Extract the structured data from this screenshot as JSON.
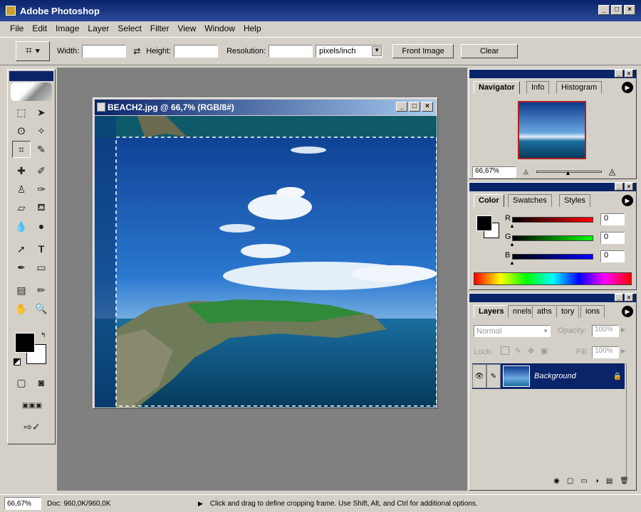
{
  "window": {
    "title": "Adobe Photoshop"
  },
  "menu": [
    "File",
    "Edit",
    "Image",
    "Layer",
    "Select",
    "Filter",
    "View",
    "Window",
    "Help"
  ],
  "options": {
    "width_label": "Width:",
    "height_label": "Height:",
    "resolution_label": "Resolution:",
    "unit_value": "pixels/inch",
    "front_image": "Front Image",
    "clear": "Clear"
  },
  "document": {
    "title": "BEACH2.jpg @ 66,7% (RGB/8#)"
  },
  "navigator": {
    "tabs": [
      "Navigator",
      "Info",
      "Histogram"
    ],
    "zoom": "66,67%"
  },
  "color": {
    "tabs": [
      "Color",
      "Swatches",
      "Styles"
    ],
    "channels": [
      {
        "label": "R",
        "value": "0"
      },
      {
        "label": "G",
        "value": "0"
      },
      {
        "label": "B",
        "value": "0"
      }
    ]
  },
  "layers": {
    "tabs": [
      "Layers",
      "nnels",
      "aths",
      "tory",
      "ions"
    ],
    "blend_mode": "Normal",
    "opacity_label": "Opacity:",
    "opacity_value": "100%",
    "lock_label": "Lock:",
    "fill_label": "Fill:",
    "fill_value": "100%",
    "layer_name": "Background"
  },
  "status": {
    "zoom": "66,67%",
    "doc": "Doc: 960,0K/960,0K",
    "hint": "Click and drag to define cropping frame. Use Shift, Alt, and Ctrl for additional options."
  }
}
